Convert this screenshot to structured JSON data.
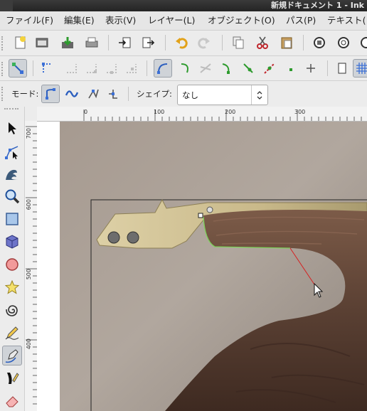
{
  "window": {
    "title": "新規ドキュメント 1 - Ink"
  },
  "menubar": {
    "items": [
      "ファイル(F)",
      "編集(E)",
      "表示(V)",
      "レイヤー(L)",
      "オブジェクト(O)",
      "パス(P)",
      "テキスト("
    ]
  },
  "commands_bar": {
    "icons": [
      "new-document-icon",
      "open-icon",
      "save-icon",
      "print-icon",
      "import-icon",
      "export-icon",
      "undo-icon",
      "redo-icon",
      "copy-icon",
      "cut-icon",
      "paste-icon",
      "zoom-selection-icon",
      "zoom-drawing-icon"
    ]
  },
  "snap_bar": {
    "icons": [
      "snap-toggle-icon",
      "snap-bbox-icon",
      "snap-bbox-edge-icon",
      "snap-bbox-corner-icon",
      "snap-bbox-midpoint-icon",
      "snap-bbox-center-icon",
      "snap-nodes-icon",
      "snap-path-icon",
      "snap-intersection-icon",
      "snap-cusp-icon",
      "snap-smooth-icon",
      "snap-line-midpoint-icon",
      "snap-object-center-icon",
      "snap-rotation-center-icon",
      "snap-page-icon",
      "snap-grid-icon"
    ]
  },
  "tool_controls": {
    "mode_label": "モード:",
    "shape_label": "シェイプ:",
    "shape_value": "なし"
  },
  "rulers": {
    "horizontal_labels": [
      "0",
      "100",
      "200",
      "300"
    ],
    "vertical_labels": [
      "700",
      "600",
      "500",
      "400"
    ]
  },
  "toolbox": {
    "tools": [
      "selector-tool-icon",
      "node-tool-icon",
      "tweak-tool-icon",
      "zoom-tool-icon",
      "rectangle-tool-icon",
      "box3d-tool-icon",
      "ellipse-tool-icon",
      "star-tool-icon",
      "spiral-tool-icon",
      "pencil-tool-icon",
      "bezier-pen-tool-icon",
      "calligraphy-tool-icon",
      "eraser-tool-icon"
    ],
    "active_tool": "bezier-pen-tool-icon"
  },
  "colors": {
    "wood_dark": "#5a4033",
    "wood_mid": "#7a5a48",
    "metal": "#c9b98a",
    "background_photo": "#9a8f86",
    "path_highlight": "#7dd35a",
    "pen_line": "#d62020",
    "accent_blue": "#3b6fd6"
  }
}
